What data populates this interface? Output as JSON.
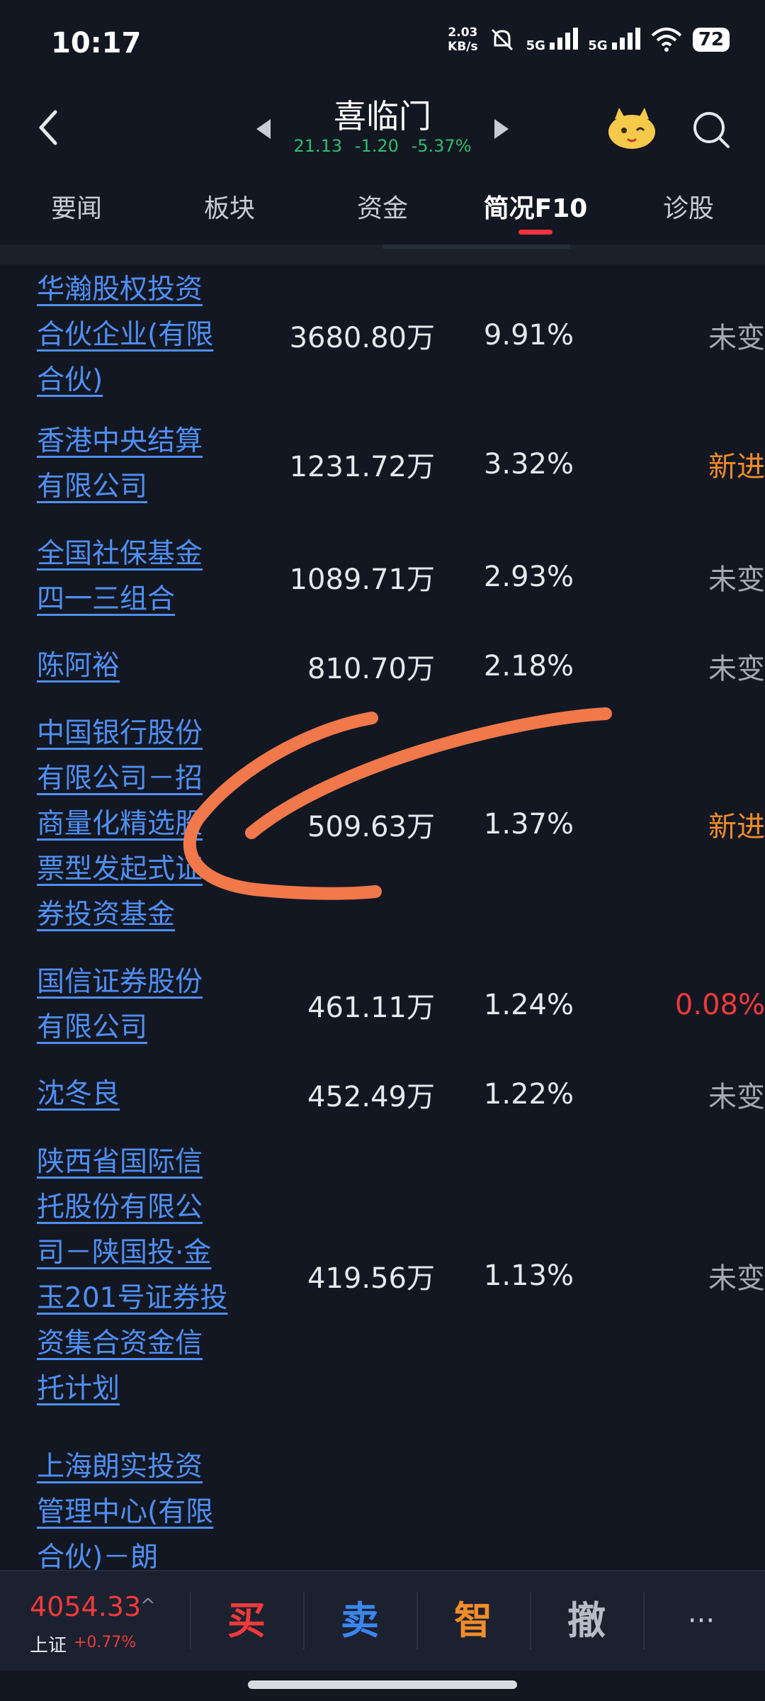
{
  "status_bar": {
    "time": "10:17",
    "net_speed": "2.03",
    "net_unit": "KB/s",
    "sig1": "5G",
    "sig2": "5G",
    "battery": "72"
  },
  "header": {
    "stock_name": "喜临门",
    "price": "21.13",
    "change": "-1.20",
    "change_pct": "-5.37%"
  },
  "tabs": [
    {
      "label": "要闻",
      "active": false
    },
    {
      "label": "板块",
      "active": false
    },
    {
      "label": "资金",
      "active": false
    },
    {
      "label": "简况F10",
      "active": true
    },
    {
      "label": "诊股",
      "active": false
    }
  ],
  "holders": [
    {
      "name": "华瀚股权投资合伙企业(有限合伙)",
      "shares": "3680.80万",
      "ratio": "9.91%",
      "change": "未变",
      "change_type": "same"
    },
    {
      "name": "香港中央结算有限公司",
      "shares": "1231.72万",
      "ratio": "3.32%",
      "change": "新进",
      "change_type": "new"
    },
    {
      "name": "全国社保基金四一三组合",
      "shares": "1089.71万",
      "ratio": "2.93%",
      "change": "未变",
      "change_type": "same"
    },
    {
      "name": "陈阿裕",
      "shares": "810.70万",
      "ratio": "2.18%",
      "change": "未变",
      "change_type": "same"
    },
    {
      "name": "中国银行股份有限公司－招商量化精选股票型发起式证券投资基金",
      "shares": "509.63万",
      "ratio": "1.37%",
      "change": "新进",
      "change_type": "new"
    },
    {
      "name": "国信证券股份有限公司",
      "shares": "461.11万",
      "ratio": "1.24%",
      "change": "0.08%",
      "change_type": "up"
    },
    {
      "name": "沈冬良",
      "shares": "452.49万",
      "ratio": "1.22%",
      "change": "未变",
      "change_type": "same"
    },
    {
      "name": "陕西省国际信托股份有限公司－陕国投·金玉201号证券投资集合资金信托计划",
      "shares": "419.56万",
      "ratio": "1.13%",
      "change": "未变",
      "change_type": "same"
    },
    {
      "name": "上海朗实投资管理中心(有限合伙)－朗",
      "shares": "",
      "ratio": "",
      "change": "",
      "change_type": "new"
    }
  ],
  "bottom_bar": {
    "index_value": "4054.33",
    "index_name": "上证",
    "index_change": "+0.77%",
    "buy": "买",
    "sell": "卖",
    "smart": "智",
    "cancel": "撤",
    "more": "···"
  }
}
